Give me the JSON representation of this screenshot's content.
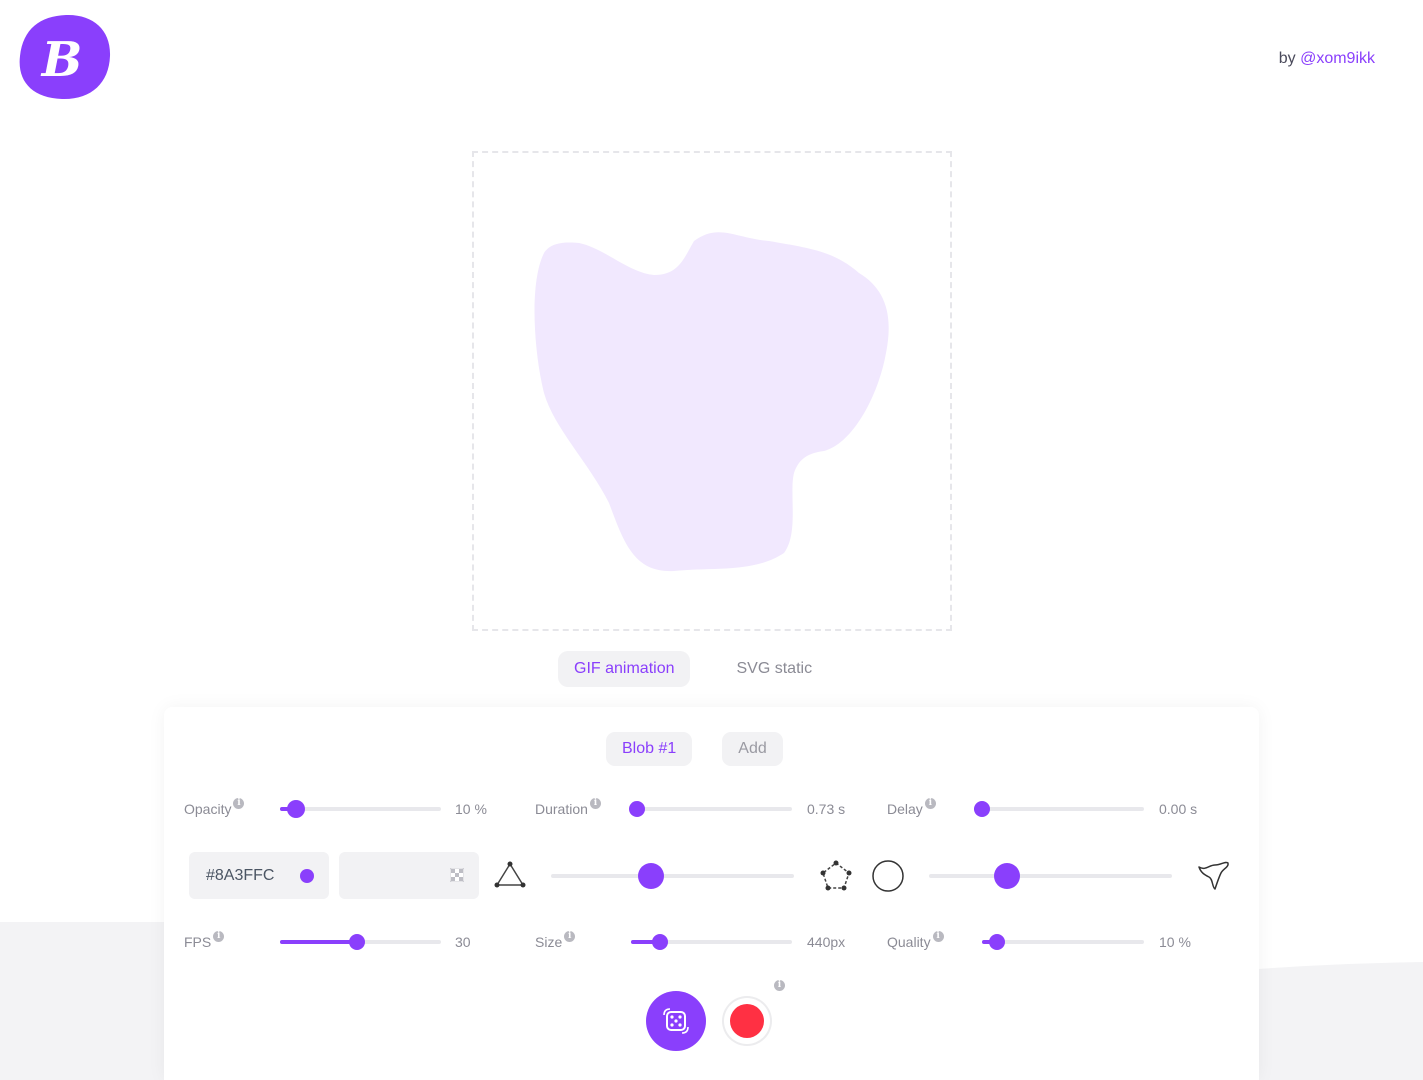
{
  "brand": {
    "logo_letter": "B",
    "logo_color": "#8a3ffc"
  },
  "author": {
    "prefix": "by",
    "handle": "@xom9ikk"
  },
  "preview": {
    "blob_color": "#f1e8fe"
  },
  "mode_tabs": [
    {
      "label": "GIF animation",
      "active": true
    },
    {
      "label": "SVG static",
      "active": false
    }
  ],
  "blob_tabs": [
    {
      "label": "Blob #1",
      "active": true
    },
    {
      "label": "Add",
      "active": false
    }
  ],
  "controls": {
    "opacity": {
      "label": "Opacity",
      "value": "10 %",
      "level": 0.1
    },
    "duration": {
      "label": "Duration",
      "value": "0.73 s",
      "level": 0.04
    },
    "delay": {
      "label": "Delay",
      "value": "0.00 s",
      "level": 0.0
    },
    "fps": {
      "label": "FPS",
      "value": "30",
      "level": 0.48
    },
    "size": {
      "label": "Size",
      "value": "440px",
      "level": 0.18
    },
    "quality": {
      "label": "Quality",
      "value": "10 %",
      "level": 0.09
    },
    "complexity": {
      "level": 0.41
    },
    "contrast": {
      "level": 0.32
    }
  },
  "color": {
    "value": "#8A3FFC",
    "swatch": "#8a3ffc"
  },
  "accent": "#8a3ffc",
  "record_color": "#ff3043",
  "info_glyph": "i"
}
